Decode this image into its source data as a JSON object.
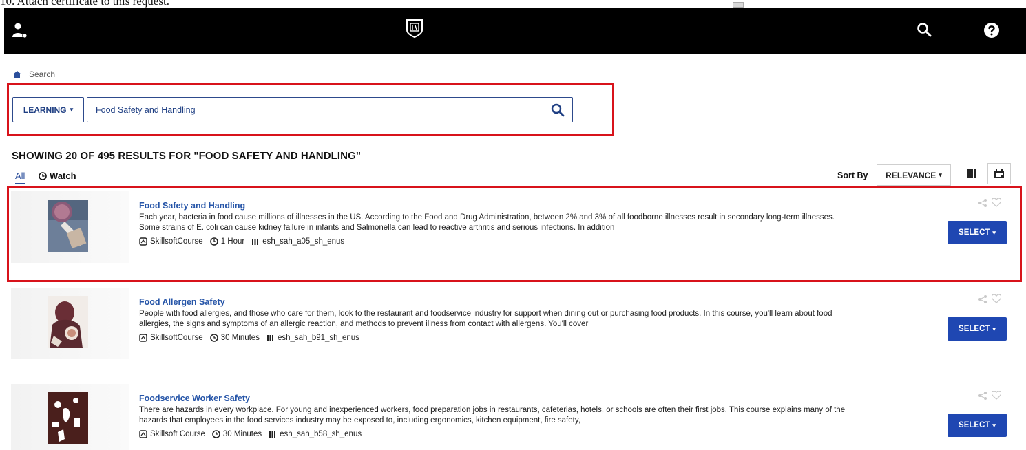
{
  "document": {
    "caption": "10. Attach certificate to this request."
  },
  "breadcrumb": {
    "label": "Search"
  },
  "search": {
    "scope_label": "LEARNING",
    "query": "Food Safety and Handling"
  },
  "results_heading": "SHOWING 20 OF 495 RESULTS FOR \"FOOD SAFETY AND HANDLING\"",
  "filters": {
    "all_label": "All",
    "watch_label": "Watch"
  },
  "sort": {
    "label": "Sort By",
    "value": "RELEVANCE"
  },
  "results": [
    {
      "title": "Food Safety and Handling",
      "description": "Each year, bacteria in food cause millions of illnesses in the US. According to the Food and Drug Administration, between 2% and 3% of all foodborne illnesses result in secondary long-term illnesses. Some strains of E. coli can cause kidney failure in infants and Salmonella can lead to reactive arthritis and serious infections. In addition",
      "type": "SkillsoftCourse",
      "duration": "1 Hour",
      "code": "esh_sah_a05_sh_enus",
      "select_label": "SELECT"
    },
    {
      "title": "Food Allergen Safety",
      "description": "People with food allergies, and those who care for them, look to the restaurant and foodservice industry for support when dining out or purchasing food products. In this course, you'll learn about food allergies, the signs and symptoms of an allergic reaction, and methods to prevent illness from contact with allergens. You'll cover",
      "type": "SkillsoftCourse",
      "duration": "30 Minutes",
      "code": "esh_sah_b91_sh_enus",
      "select_label": "SELECT"
    },
    {
      "title": "Foodservice Worker Safety",
      "description": "There are hazards in every workplace. For young and inexperienced workers, food preparation jobs in restaurants, cafeterias, hotels, or schools are often their first jobs. This course explains many of the hazards that employees in the food services industry may be exposed to, including ergonomics, kitchen equipment, fire safety,",
      "type": "Skillsoft Course",
      "duration": "30 Minutes",
      "code": "esh_sah_b58_sh_enus",
      "select_label": "SELECT"
    }
  ],
  "colors": {
    "accent": "#1f47b2",
    "link": "#2655a8",
    "highlight": "#d8131b",
    "topbar": "#000000"
  },
  "icons": [
    "user-settings-icon",
    "logo-shield-icon",
    "search-icon",
    "help-icon",
    "home-icon",
    "chevron-down-icon",
    "watch-icon",
    "list-view-icon",
    "grid-view-icon",
    "course-icon",
    "clock-icon",
    "code-icon",
    "share-icon",
    "heart-icon"
  ]
}
